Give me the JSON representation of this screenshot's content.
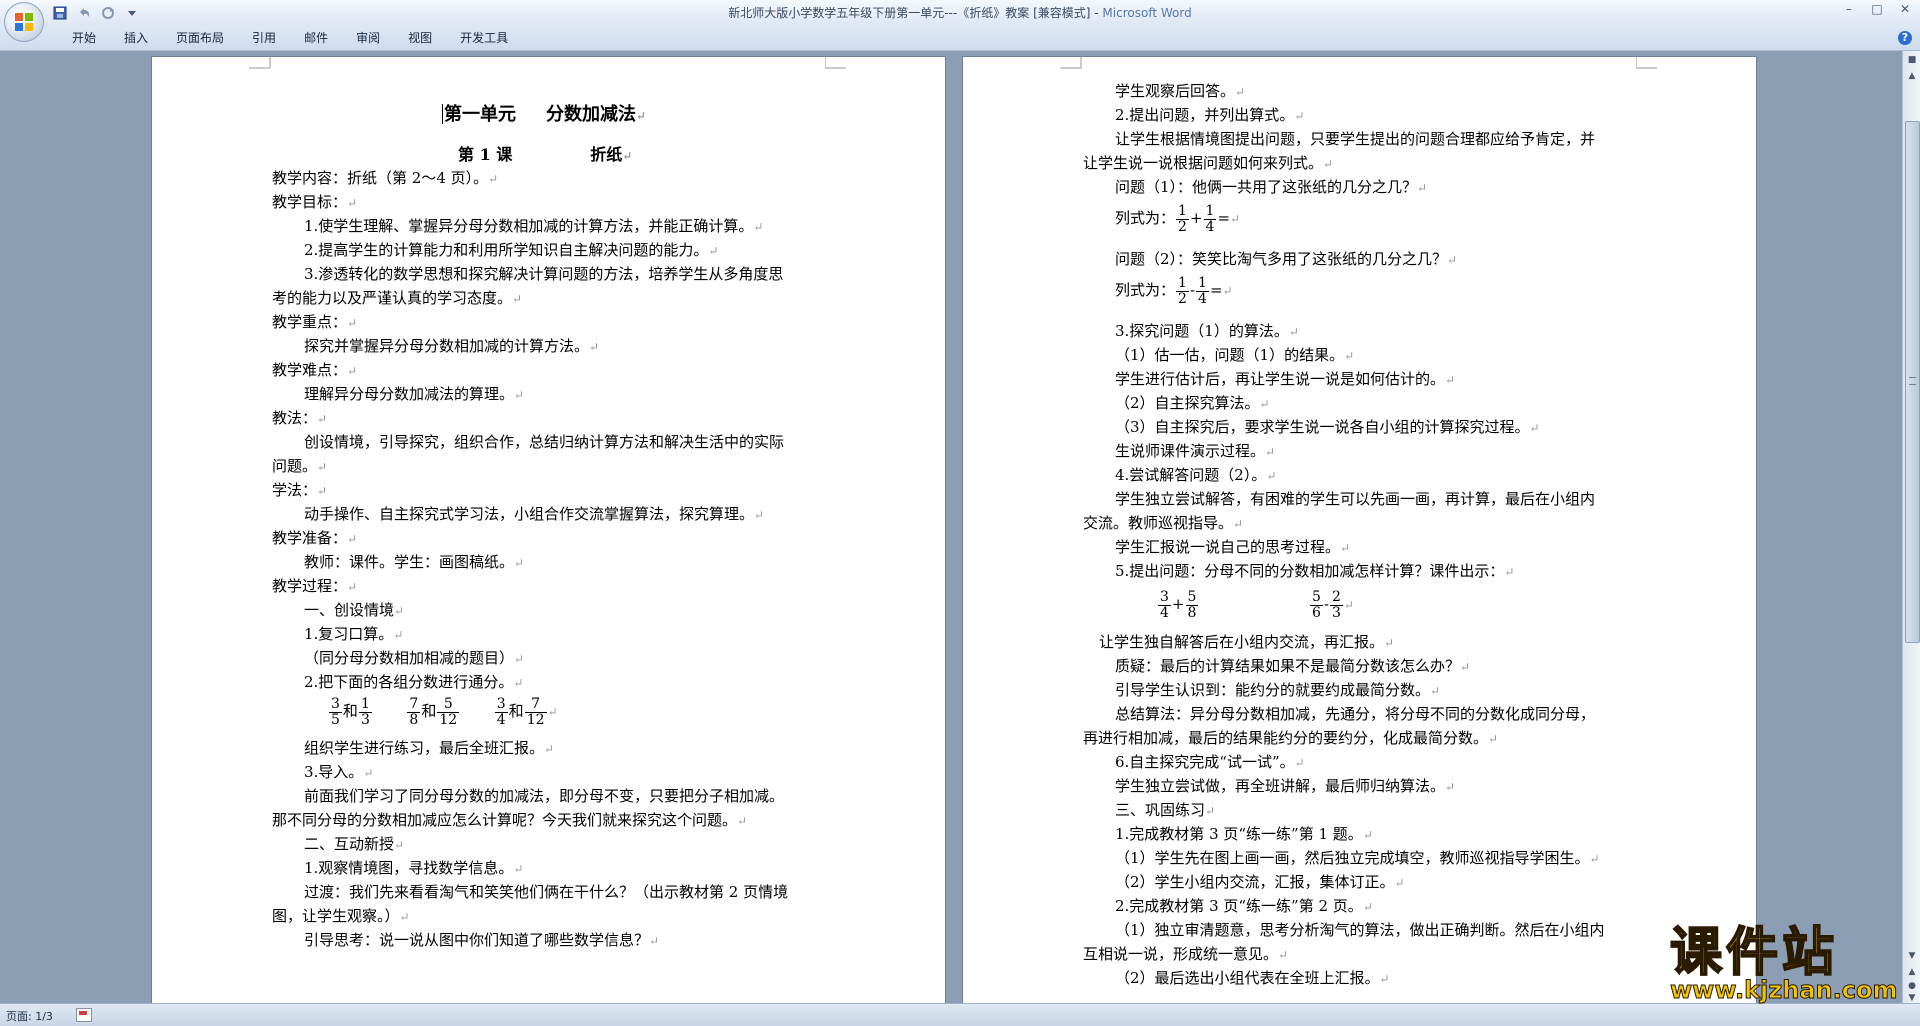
{
  "window": {
    "title": "新北师大版小学数学五年级下册第一单元---《折纸》教案 [兼容模式] - ",
    "app_name": "Microsoft Word"
  },
  "quick_access": [
    "save-icon",
    "undo-icon",
    "redo-icon",
    "customize-icon"
  ],
  "ribbon": {
    "tabs": [
      "开始",
      "插入",
      "页面布局",
      "引用",
      "邮件",
      "审阅",
      "视图",
      "开发工具"
    ]
  },
  "page1": {
    "title1": "第一单元",
    "title1b": "分数加减法",
    "title2": "第 1 课",
    "title2b": "折纸",
    "lines": [
      "教学内容：折纸（第 2～4 页）。",
      "教学目标：",
      "1.使学生理解、掌握异分母分数相加减的计算方法，并能正确计算。",
      "2.提高学生的计算能力和利用所学知识自主解决问题的能力。",
      "3.渗透转化的数学思想和探究解决计算问题的方法，培养学生从多角度思",
      "考的能力以及严谨认真的学习态度。",
      "教学重点：",
      "探究并掌握异分母分数相加减的计算方法。",
      "教学难点：",
      "理解异分母分数加减法的算理。",
      "教法：",
      "创设情境，引导探究，组织合作，总结归纳计算方法和解决生活中的实际",
      "问题。",
      "学法：",
      "动手操作、自主探究式学习法，小组合作交流掌握算法，探究算理。",
      "教学准备：",
      "教师：课件。学生：画图稿纸。",
      "教学过程：",
      "一、创设情境",
      "1.复习口算。",
      "（同分母分数相加相减的题目）",
      "2.把下面的各组分数进行通分。",
      "组织学生进行练习，最后全班汇报。",
      "3.导入。",
      "前面我们学习了同分母分数的加减法，即分母不变，只要把分子相加减。",
      "那不同分母的分数相加减应怎么计算呢？今天我们就来探究这个问题。",
      "二、互动新授",
      "1.观察情境图，寻找数学信息。",
      "过渡：我们先来看看淘气和笑笑他们俩在干什么？（出示教材第  2  页情境",
      "图，让学生观察。）",
      "引导思考：说一说从图中你们知道了哪些数学信息？"
    ],
    "fractions": {
      "pairs": [
        {
          "a": [
            "3",
            "5"
          ],
          "b": [
            "1",
            "3"
          ]
        },
        {
          "a": [
            "7",
            "8"
          ],
          "b": [
            "5",
            "12"
          ]
        },
        {
          "a": [
            "3",
            "4"
          ],
          "b": [
            "7",
            "12"
          ]
        }
      ],
      "joiner": "和"
    }
  },
  "page2": {
    "lines": [
      "学生观察后回答。",
      "2.提出问题，并列出算式。",
      "让学生根据情境图提出问题，只要学生提出的问题合理都应给予肯定，并",
      "让学生说一说根据问题如何来列式。",
      "问题（1）：他俩一共用了这张纸的几分之几？",
      "问题（2）：笑笑比淘气多用了这张纸的几分之几？",
      "3.探究问题（1）的算法。",
      "（1）估一估，问题（1）的结果。",
      "学生进行估计后，再让学生说一说是如何估计的。",
      "（2）自主探究算法。",
      "（3）自主探究后，要求学生说一说各自小组的计算探究过程。",
      "生说师课件演示过程。",
      "4.尝试解答问题（2）。",
      "学生独立尝试解答，有困难的学生可以先画一画，再计算，最后在小组内",
      "交流。教师巡视指导。",
      "学生汇报说一说自己的思考过程。",
      "5.提出问题：分母不同的分数相加减怎样计算？课件出示：",
      "让学生独自解答后在小组内交流，再汇报。",
      "质疑：最后的计算结果如果不是最简分数该怎么办？",
      "引导学生认识到：能约分的就要约成最简分数。",
      "总结算法：异分母分数相加减，先通分，将分母不同的分数化成同分母，",
      "再进行相加减，最后的结果能约分的要约分，化成最简分数。",
      "6.自主探究完成“试一试”。",
      "学生独立尝试做，再全班讲解，最后师归纳算法。",
      "三、巩固练习",
      "1.完成教材第 3 页“练一练”第 1 题。",
      "（1）学生先在图上画一画，然后独立完成填空，教师巡视指导学困生。",
      "（2）学生小组内交流，汇报，集体订正。",
      "2.完成教材第 3 页“练一练”第 2 页。",
      "（1）独立审清题意，思考分析淘气的算法，做出正确判断。然后在小组内",
      "互相说一说，形成统一意见。",
      "（2）最后选出小组代表在全班上汇报。"
    ],
    "formula_label": "列式为：",
    "formula1": {
      "f1": [
        "1",
        "2"
      ],
      "op": "+",
      "f2": [
        "1",
        "4"
      ],
      "eq": "="
    },
    "formula2": {
      "f1": [
        "1",
        "2"
      ],
      "op": "-",
      "f2": [
        "1",
        "4"
      ],
      "eq": "="
    },
    "task": {
      "f1": [
        "3",
        "4"
      ],
      "op1": "+",
      "f2": [
        "5",
        "8"
      ],
      "f3": [
        "5",
        "6"
      ],
      "op2": "-",
      "f4": [
        "2",
        "3"
      ]
    }
  },
  "status": {
    "page": "页面: 1/3"
  },
  "watermark": {
    "main": "课件站",
    "url": "www.kjzhan.com"
  }
}
